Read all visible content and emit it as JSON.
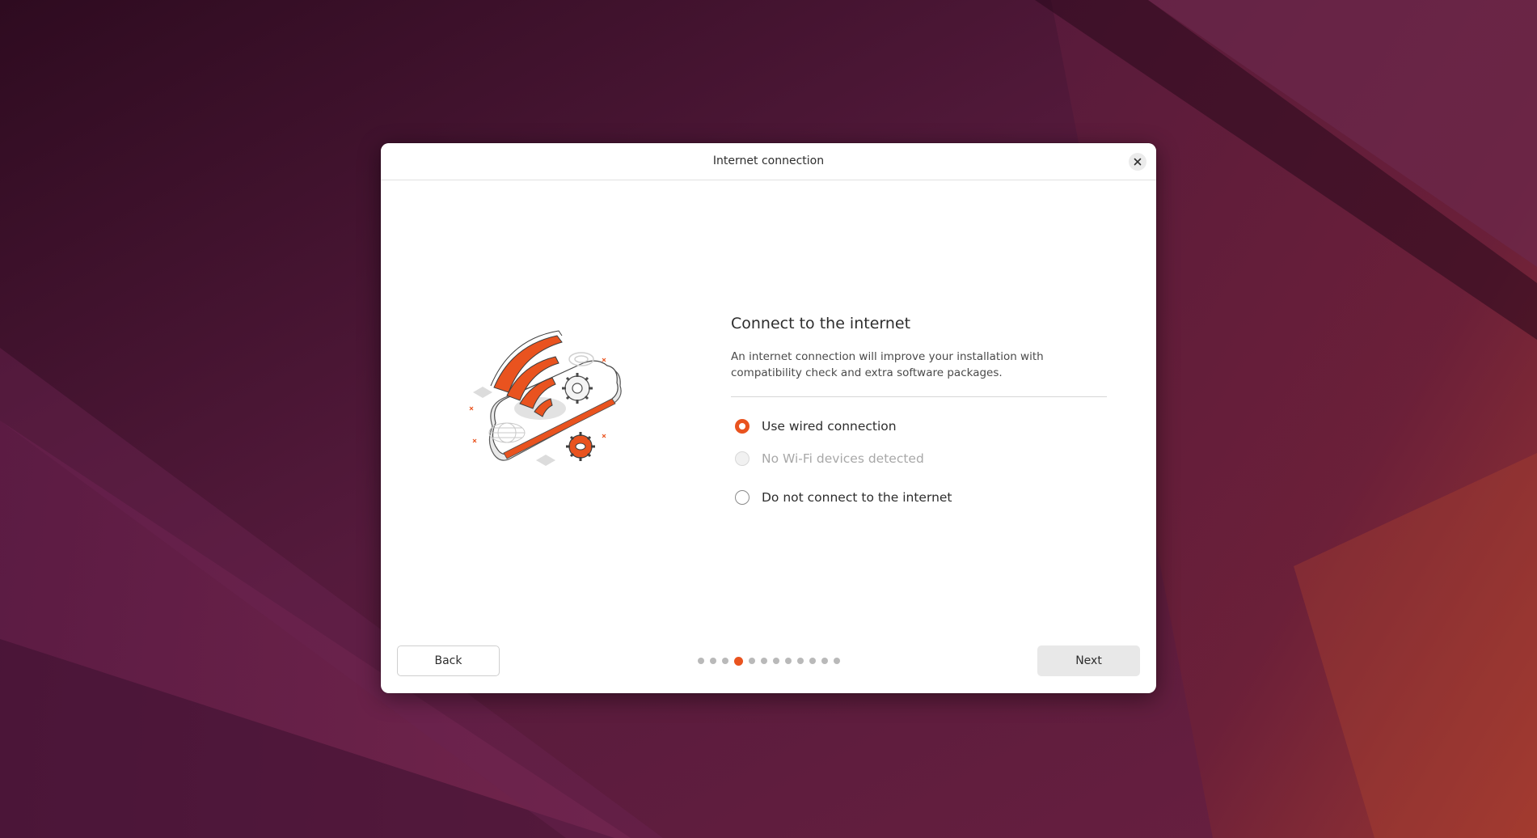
{
  "window": {
    "title": "Internet connection",
    "close_icon": "close-icon"
  },
  "main": {
    "heading": "Connect to the internet",
    "description": "An internet connection will improve your installation with compatibility check and extra software packages.",
    "illustration_icon": "wifi-cloud-illustration"
  },
  "options": [
    {
      "label": "Use wired connection",
      "checked": true,
      "disabled": false
    },
    {
      "label": "No Wi-Fi devices detected",
      "checked": false,
      "disabled": true
    },
    {
      "label": "Do not connect to the internet",
      "checked": false,
      "disabled": false
    }
  ],
  "footer": {
    "back_label": "Back",
    "next_label": "Next",
    "step_total": 12,
    "step_current": 4
  },
  "colors": {
    "accent": "#e9531f",
    "desktop_base": "#4a1838"
  }
}
